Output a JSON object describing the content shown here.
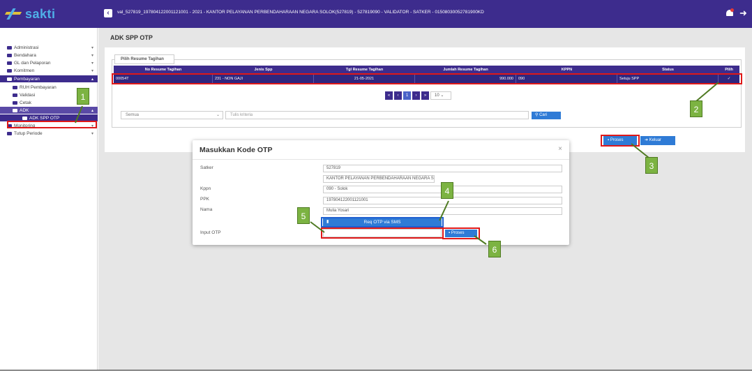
{
  "header": {
    "app_name": "sakti",
    "collapse_icon": "chevron-left-icon",
    "context": "val_527819_197804122001121001 - 2021 - KANTOR PELAYANAN PERBENDAHARAAN NEGARA SOLOK(527819) - 527819090 - VALIDATOR - SATKER - 01508030052781900KD",
    "bell_icon": "bell-icon",
    "logout_icon": "logout-icon"
  },
  "sidebar": {
    "items": [
      {
        "label": "Administrasi"
      },
      {
        "label": "Bendahara"
      },
      {
        "label": "GL dan Pelaporan"
      },
      {
        "label": "Komitmen"
      },
      {
        "label": "Pembayaran"
      },
      {
        "label": "RUH Pembayaran"
      },
      {
        "label": "Validasi"
      },
      {
        "label": "Cetak"
      },
      {
        "label": "ADK"
      },
      {
        "label": "ADK SPP OTP"
      },
      {
        "label": "Monitoring"
      },
      {
        "label": "Tutup Periode"
      }
    ]
  },
  "main": {
    "page_title": "ADK SPP OTP",
    "legend": "Pilih Resume Tagihan",
    "table": {
      "headers": [
        "No Resume Tagihan",
        "Jenis Spp",
        "Tgl Resume Tagihan",
        "Jumlah Resume Tagihan",
        "KPPN",
        "Status",
        "Pilih"
      ],
      "row": [
        "00054T",
        "231 - NON GAJI",
        "21-05-2021",
        "990.000",
        "090",
        "Setuju SPP",
        "✓"
      ]
    },
    "pager": {
      "first": "«",
      "prev": "‹",
      "current": "1",
      "next": "›",
      "last": "»",
      "page_size": "10"
    },
    "filter": {
      "select_value": "Semua",
      "input_placeholder": "Tulis kriteria",
      "search_label": "Cari"
    },
    "buttons": {
      "proses": "Proses",
      "keluar": "Keluar"
    }
  },
  "modal": {
    "title": "Masukkan Kode OTP",
    "close": "×",
    "fields": [
      {
        "label": "Satker",
        "value": "527819"
      },
      {
        "label": "",
        "value": "KANTOR PELAYANAN PERBENDAHARAAN NEGARA SOLOK"
      },
      {
        "label": "Kppn",
        "value": "090 - Solok"
      },
      {
        "label": "PPK",
        "value": "197804122001121001"
      },
      {
        "label": "Nama",
        "value": "Mulia Yosari"
      }
    ],
    "req_otp_label": "Req OTP via SMS",
    "input_otp_label": "Input OTP",
    "input_otp_value": "",
    "proses_label": "Proses"
  },
  "callouts": [
    "1",
    "2",
    "3",
    "4",
    "5",
    "6"
  ],
  "colors": {
    "primary": "#3d2c8d",
    "button": "#2f7bd6",
    "highlight": "#e01818",
    "callout": "#7cb342"
  }
}
